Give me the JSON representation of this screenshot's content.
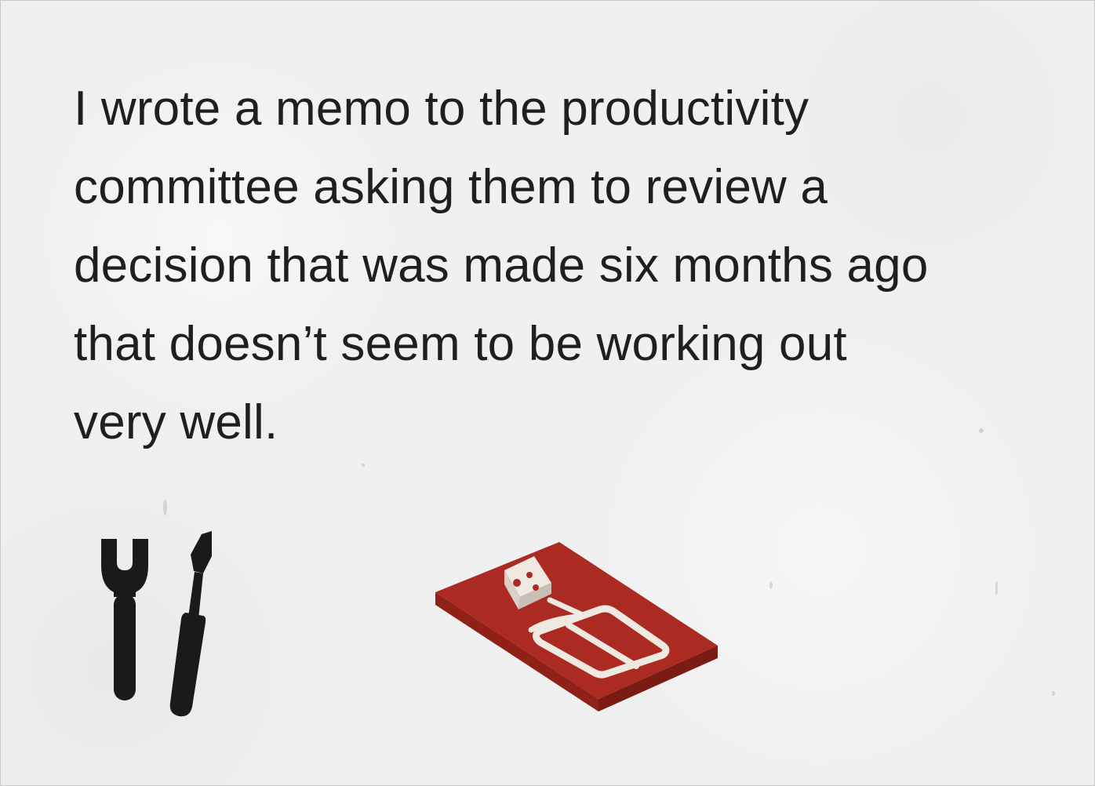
{
  "quote": {
    "lines": [
      "I wrote a memo to the productivity",
      "committee asking them to review a",
      "decision that was made six months ago",
      "that doesn’t seem to be working out",
      "very well."
    ]
  },
  "icons": {
    "left": "wrench-screwdriver-icon",
    "right": "mousetrap-icon"
  },
  "colors": {
    "background": "#f0f0f0",
    "text": "#1f1f1f",
    "icon_dark": "#1a1a1a",
    "trap_red": "#ab2a22",
    "trap_light": "#efe9e2"
  }
}
